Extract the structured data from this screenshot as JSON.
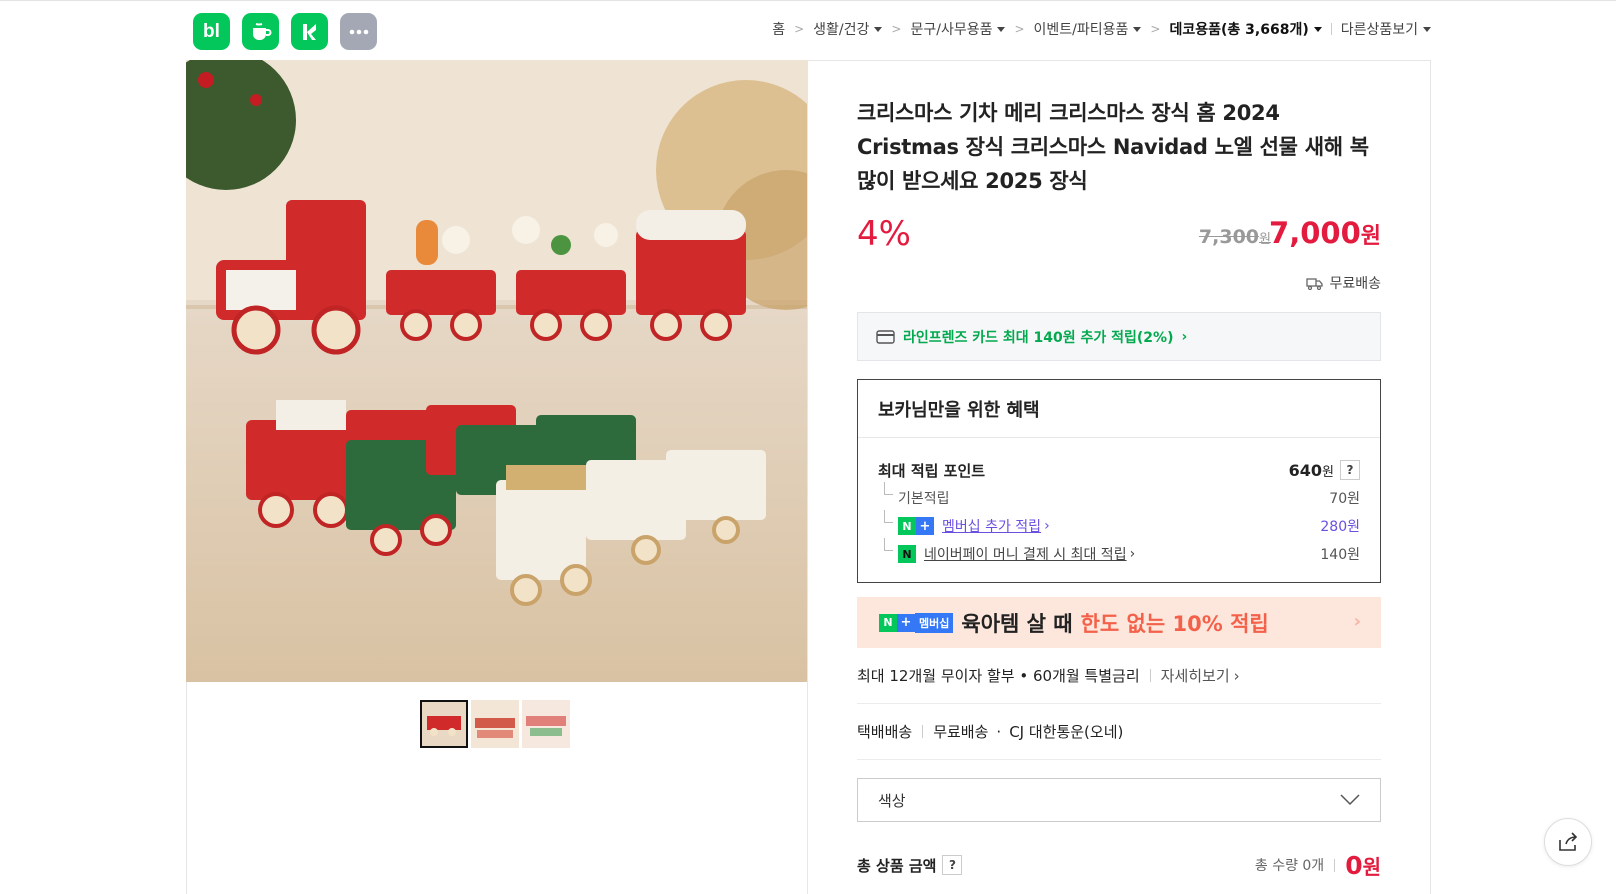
{
  "app_icons": [
    {
      "name": "blog-icon",
      "label": "bl"
    },
    {
      "name": "cafe-icon",
      "label": ""
    },
    {
      "name": "naver-icon",
      "label": ""
    },
    {
      "name": "more-apps-icon",
      "label": ""
    }
  ],
  "breadcrumb": {
    "home": "홈",
    "level1": "생활/건강",
    "level2": "문구/사무용품",
    "level3": "이벤트/파티용품",
    "level4": "데코용품(총 3,668개)",
    "other": "다른상품보기"
  },
  "product": {
    "title": "크리스마스 기차 메리 크리스마스 장식 홈 2024 Cristmas 장식 크리스마스 Navidad 노엘 선물 새해 복 많이 받으세요 2025 장식",
    "discount": "4%",
    "original_price": "7,300",
    "original_unit": "원",
    "sale_price": "7,000",
    "sale_unit": "원",
    "shipping": "무료배송"
  },
  "card_offer": "라인프렌즈 카드 최대 140원 추가 적립(2%)",
  "benefit": {
    "title": "보카님만을 위한 혜택",
    "max_label": "최대 적립 포인트",
    "max_value": "640",
    "max_unit": "원",
    "help": "?",
    "rows": [
      {
        "label": "기본적립",
        "value": "70원"
      },
      {
        "label": "멤버십 추가 적립",
        "value": "280원"
      },
      {
        "label": "네이버페이 머니 결제 시 최대 적립",
        "value": "140원"
      }
    ]
  },
  "promo": {
    "member_tag": "멤버십",
    "text1": "육아템 살 때",
    "text2": "한도 없는 10% 적립"
  },
  "installment": {
    "text": "최대 12개월 무이자 할부 • 60개월 특별금리",
    "link": "자세히보기"
  },
  "delivery": {
    "type": "택배배송",
    "fee": "무료배송",
    "carrier": "CJ 대한통운(오네)"
  },
  "option_select": {
    "placeholder": "색상"
  },
  "total": {
    "label": "총 상품 금액",
    "help": "?",
    "qty": "총 수량 0개",
    "amount": "0",
    "unit": "원"
  },
  "thumbnails": [
    "thumb-1",
    "thumb-2",
    "thumb-3"
  ],
  "colors": {
    "accent_red": "#e31c3f",
    "naver_green": "#03c75a",
    "member_blue": "#3478f6",
    "promo_bg": "#fde7dc"
  }
}
